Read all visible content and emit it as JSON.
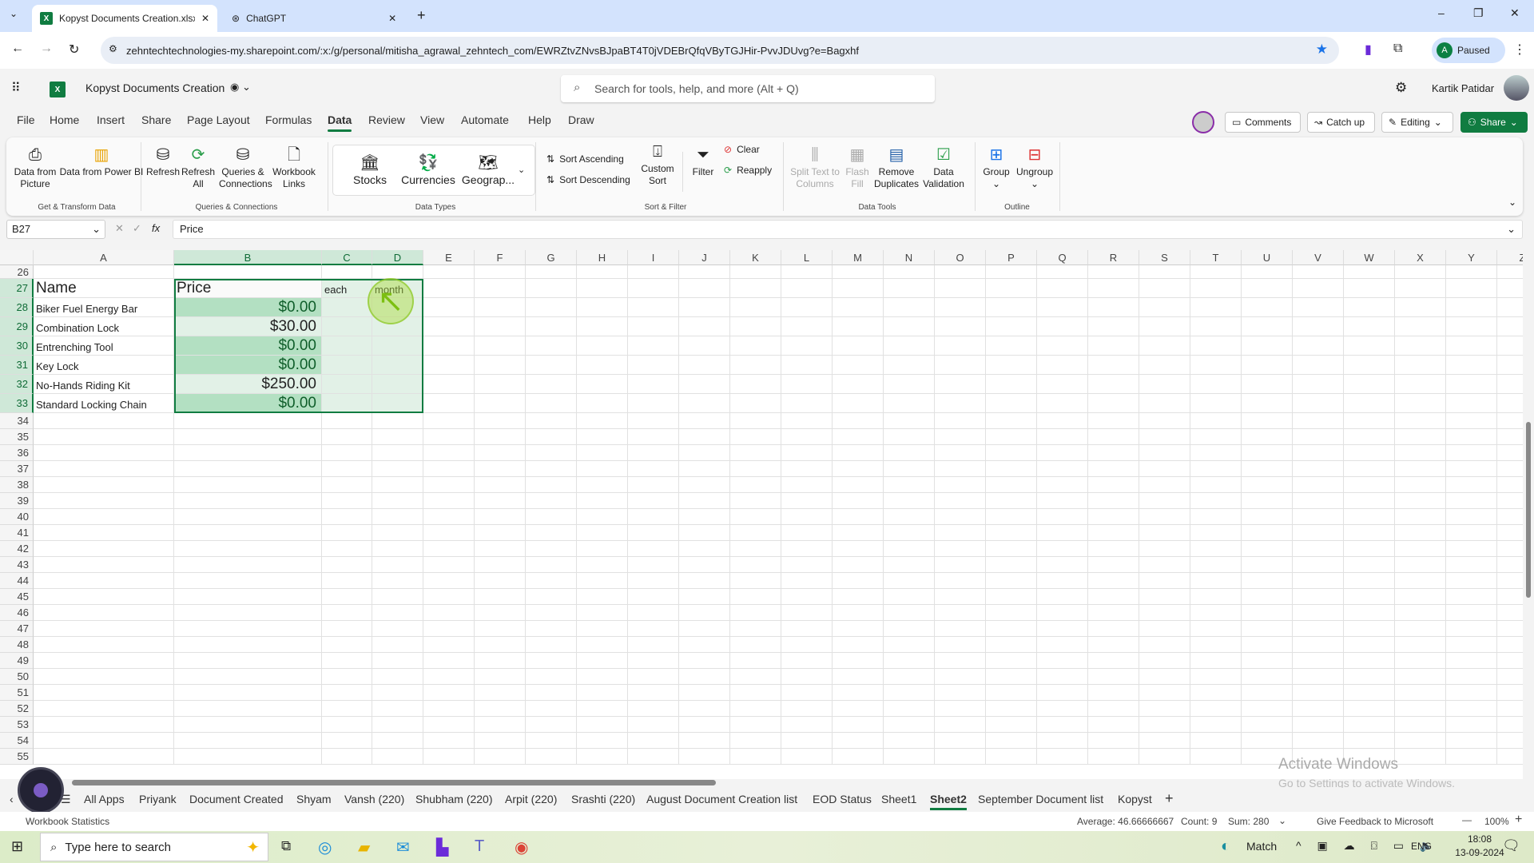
{
  "browser": {
    "tabs": [
      {
        "label": "Kopyst Documents Creation.xlsx",
        "active": true
      },
      {
        "label": "ChatGPT",
        "active": false
      }
    ],
    "url": "zehntechtechnologies-my.sharepoint.com/:x:/g/personal/mitisha_agrawal_zehntech_com/EWRZtvZNvsBJpaBT4T0jVDEBrQfqVByTGJHir-PvvJDUvg?e=Bagxhf",
    "profile_initial": "A",
    "profile_status": "Paused"
  },
  "app": {
    "title": "Kopyst Documents Creation",
    "search_placeholder": "Search for tools, help, and more (Alt + Q)",
    "user": "Kartik Patidar"
  },
  "menu": {
    "tabs": [
      "File",
      "Home",
      "Insert",
      "Share",
      "Page Layout",
      "Formulas",
      "Data",
      "Review",
      "View",
      "Automate",
      "Help",
      "Draw"
    ],
    "selected": "Data",
    "comments": "Comments",
    "catchup": "Catch up",
    "editing": "Editing",
    "share": "Share"
  },
  "ribbon": {
    "get_transform": {
      "label": "Get & Transform Data",
      "buttons": [
        "Data from Picture",
        "Data from Power BI"
      ]
    },
    "queries": {
      "label": "Queries & Connections",
      "buttons": [
        "Refresh",
        "Refresh All",
        "Queries & Connections",
        "Workbook Links"
      ]
    },
    "data_types": {
      "label": "Data Types",
      "buttons": [
        "Stocks",
        "Currencies",
        "Geograp..."
      ]
    },
    "sort_filter": {
      "label": "Sort & Filter",
      "sort_asc": "Sort Ascending",
      "sort_desc": "Sort Descending",
      "custom_sort": "Custom Sort",
      "filter": "Filter",
      "clear": "Clear",
      "reapply": "Reapply"
    },
    "data_tools": {
      "label": "Data Tools",
      "buttons": [
        "Split Text to Columns",
        "Flash Fill",
        "Remove Duplicates",
        "Data Validation"
      ]
    },
    "outline": {
      "label": "Outline",
      "buttons": [
        "Group",
        "Ungroup"
      ]
    }
  },
  "formula_bar": {
    "name_box": "B27",
    "formula": "Price"
  },
  "grid": {
    "columns": [
      "A",
      "B",
      "C",
      "D",
      "E",
      "F",
      "G",
      "H",
      "I",
      "J",
      "K",
      "L",
      "M",
      "N",
      "O",
      "P",
      "Q",
      "R",
      "S",
      "T",
      "U",
      "V",
      "W",
      "X",
      "Y",
      "Z"
    ],
    "first_row": 26,
    "last_row": 55,
    "selection": "B27:D33",
    "cells": {
      "A27": "Name",
      "B27": "Price",
      "C27": "each",
      "D27": "month",
      "A28": "Biker Fuel Energy Bar",
      "B28": "$0.00",
      "A29": "Combination Lock",
      "B29": "$30.00",
      "A30": "Entrenching Tool",
      "B30": "$0.00",
      "A31": "Key Lock",
      "B31": "$0.00",
      "A32": "No-Hands Riding Kit",
      "B32": "$250.00",
      "A33": "Standard Locking Chain",
      "B33": "$0.00"
    },
    "highlight_color": "#b3e0c2",
    "selection_color": "#107c41"
  },
  "sheets": {
    "tabs": [
      "All Apps",
      "Priyank",
      "Document Created",
      "Shyam",
      "Vansh (220)",
      "Shubham (220)",
      "Arpit (220)",
      "Srashti (220)",
      "August Document Creation list",
      "EOD Status",
      "Sheet1",
      "Sheet2",
      "September Document list",
      "Kopyst"
    ],
    "selected": "Sheet2"
  },
  "status": {
    "left": "Workbook Statistics",
    "average": "Average: 46.66666667",
    "count": "Count: 9",
    "sum": "Sum: 280",
    "feedback": "Give Feedback to Microsoft",
    "zoom": "100%",
    "watermark1": "Activate Windows",
    "watermark2": "Go to Settings to activate Windows."
  },
  "taskbar": {
    "search": "Type here to search",
    "weather": "Match",
    "lang": "ENG",
    "time": "18:08",
    "date": "13-09-2024"
  }
}
